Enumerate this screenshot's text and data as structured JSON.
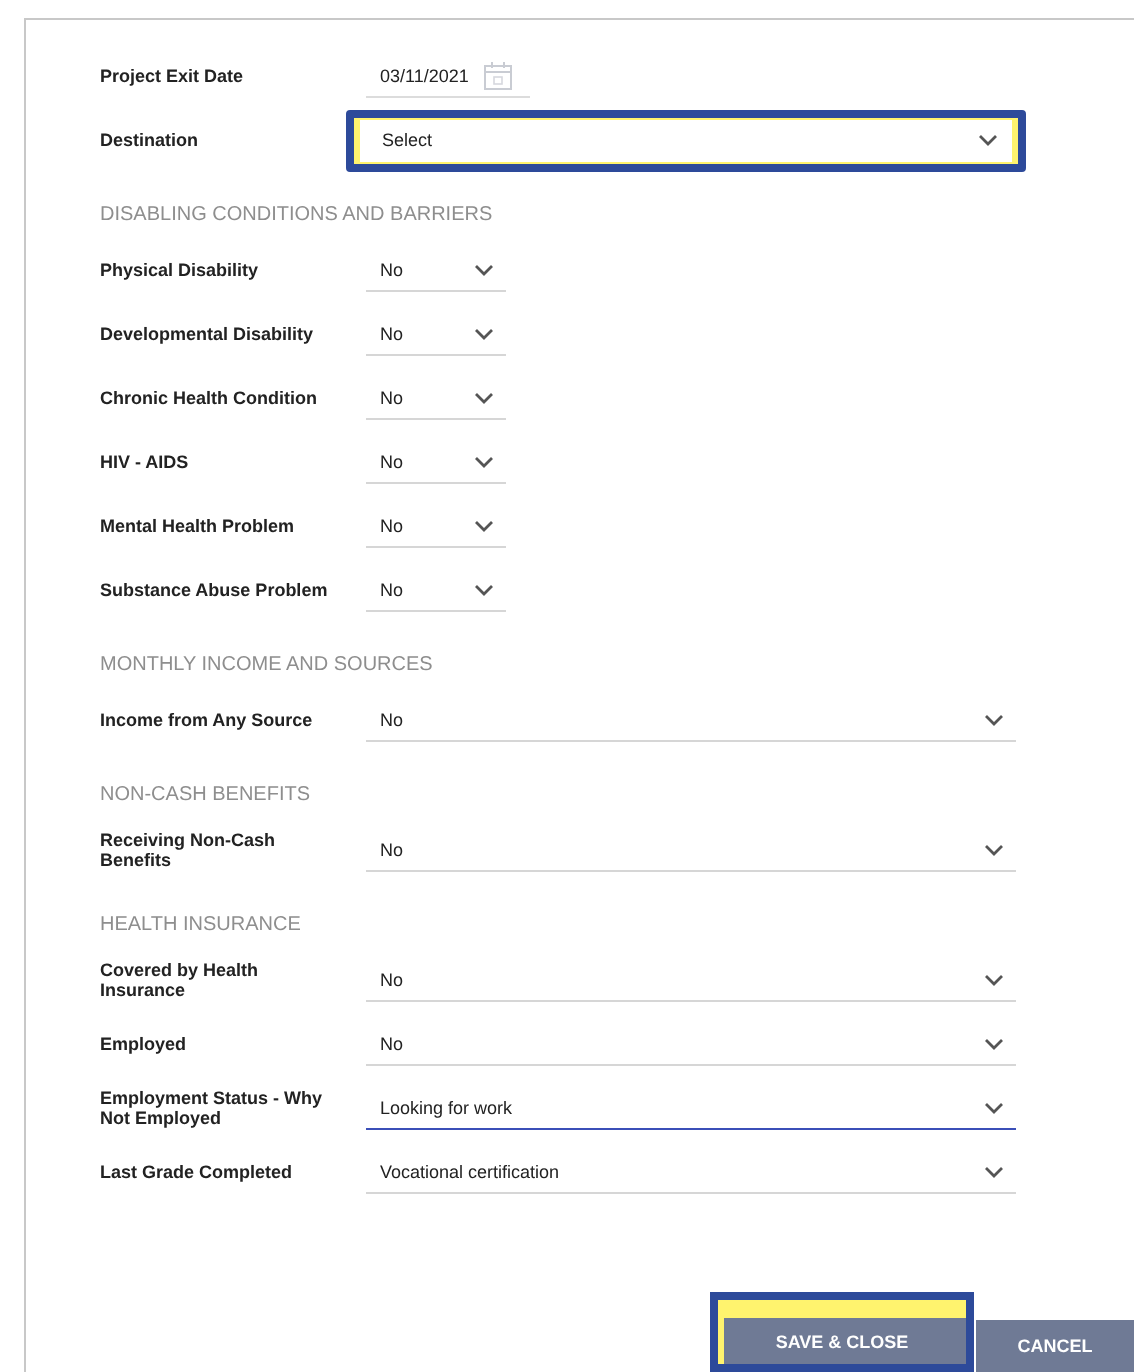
{
  "exit_date": {
    "label": "Project Exit Date",
    "value": "03/11/2021"
  },
  "destination": {
    "label": "Destination",
    "value": "Select",
    "highlighted": true
  },
  "sections": [
    {
      "heading": "DISABLING CONDITIONS AND BARRIERS",
      "fields": [
        {
          "label": "Physical Disability",
          "value": "No",
          "kind": "short",
          "active": false
        },
        {
          "label": "Developmental Disability",
          "value": "No",
          "kind": "short",
          "active": false
        },
        {
          "label": "Chronic Health Condition",
          "value": "No",
          "kind": "short",
          "active": false
        },
        {
          "label": "HIV - AIDS",
          "value": "No",
          "kind": "short",
          "active": false
        },
        {
          "label": "Mental Health Problem",
          "value": "No",
          "kind": "short",
          "active": false
        },
        {
          "label": "Substance Abuse Problem",
          "value": "No",
          "kind": "short",
          "active": false
        }
      ]
    },
    {
      "heading": "MONTHLY INCOME AND SOURCES",
      "fields": [
        {
          "label": "Income from Any Source",
          "value": "No",
          "kind": "wide",
          "active": false
        }
      ]
    },
    {
      "heading": "NON-CASH BENEFITS",
      "fields": [
        {
          "label": "Receiving Non-Cash Benefits",
          "value": "No",
          "kind": "wide",
          "active": false
        }
      ]
    },
    {
      "heading": "HEALTH INSURANCE",
      "fields": [
        {
          "label": "Covered by Health Insurance",
          "value": "No",
          "kind": "wide",
          "active": false
        },
        {
          "label": "Employed",
          "value": "No",
          "kind": "wide",
          "active": false
        },
        {
          "label": "Employment Status - Why Not Employed",
          "value": "Looking for work",
          "kind": "wide",
          "active": true
        },
        {
          "label": "Last Grade Completed",
          "value": "Vocational certification",
          "kind": "wide",
          "active": false
        }
      ]
    }
  ],
  "buttons": [
    {
      "label": "SAVE & CLOSE",
      "highlighted": true
    },
    {
      "label": "CANCEL",
      "highlighted": false
    }
  ]
}
